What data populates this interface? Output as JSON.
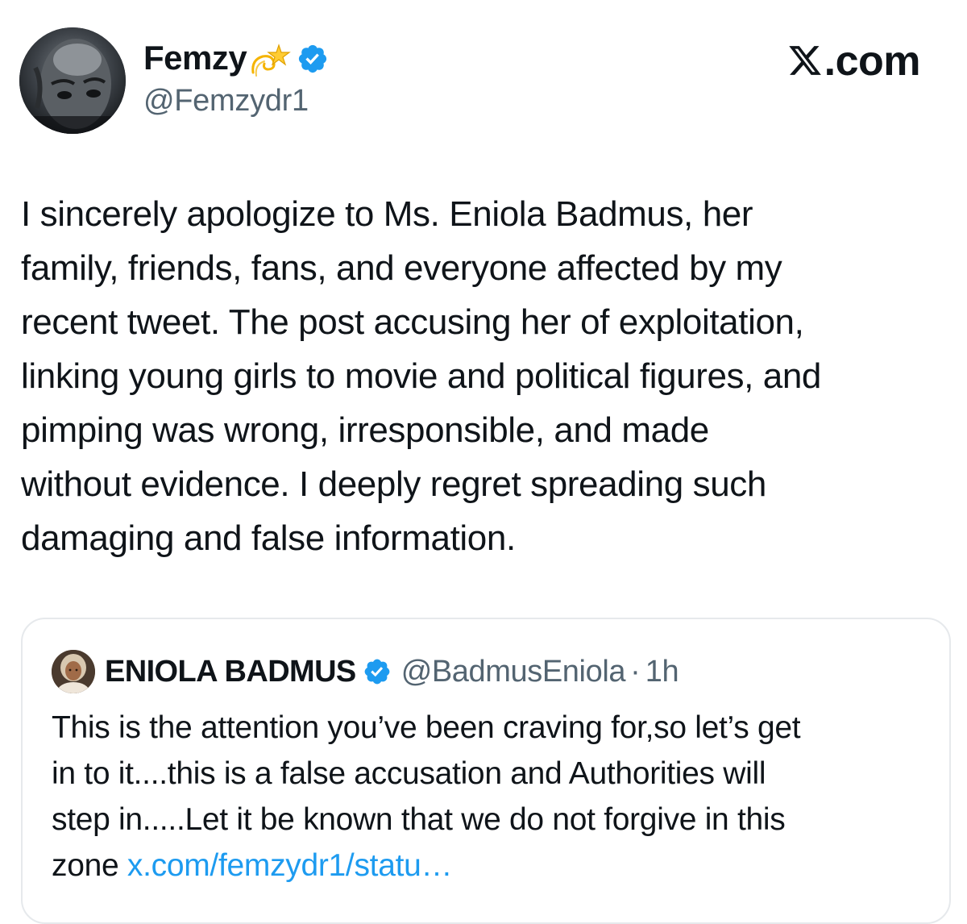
{
  "brand": {
    "logo_icon": "x-logo-icon",
    "domain_text": ".com"
  },
  "author": {
    "display_name": "Femzy",
    "emoji_icon": "dizzy-star-emoji-icon",
    "verified_icon": "verified-badge-icon",
    "handle": "@Femzydr1"
  },
  "tweet": {
    "lines": [
      "I sincerely apologize to Ms. Eniola Badmus, her",
      "family, friends, fans, and everyone affected by my",
      "recent tweet. The post accusing her of exploitation,",
      "linking young girls to movie and political figures, and",
      "pimping was wrong, irresponsible, and made",
      "without evidence. I deeply regret spreading such",
      "damaging and false information."
    ]
  },
  "quote": {
    "display_name": "ENIOLA BADMUS",
    "verified_icon": "verified-badge-icon",
    "handle": "@BadmusEniola",
    "separator": "·",
    "time": "1h",
    "lines": [
      "This is the attention you’ve been craving for,so let’s get",
      "in to it....this is a false accusation and Authorities will",
      "step in.....Let it be known that we do not forgive in this"
    ],
    "last_line_prefix": "zone ",
    "link_text": "x.com/femzydr1/statu…"
  },
  "colors": {
    "text": "#0f1419",
    "secondary_text": "#536471",
    "link": "#1d9bf0",
    "verified": "#1d9bf0",
    "card_border": "#e6e9ec"
  }
}
